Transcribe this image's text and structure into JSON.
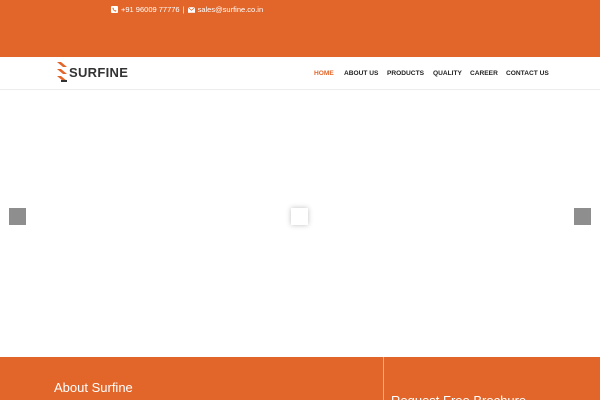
{
  "colors": {
    "brand_orange": "#e2662a",
    "nav_active": "#e2662a",
    "text_dark": "#222222"
  },
  "topbar": {
    "phone_icon": "phone-icon",
    "phone": "+91 96009 77776",
    "separator": "|",
    "mail_icon": "envelope-icon",
    "email": "sales@surfine.co.in"
  },
  "header": {
    "logo_text": "SURFINE",
    "nav": [
      {
        "label": "HOME",
        "active": true
      },
      {
        "label": "ABOUT US",
        "active": false
      },
      {
        "label": "PRODUCTS",
        "active": false
      },
      {
        "label": "QUALITY",
        "active": false
      },
      {
        "label": "CAREER",
        "active": false
      },
      {
        "label": "CONTACT US",
        "active": false
      }
    ]
  },
  "footer": {
    "about_title": "About Surfine",
    "brochure_title": "Request Free Brochure"
  }
}
